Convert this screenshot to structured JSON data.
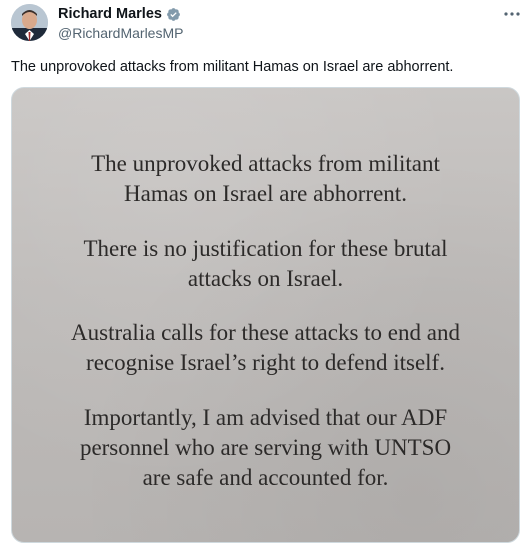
{
  "author": {
    "name": "Richard Marles",
    "handle": "@RichardMarlesMP",
    "verified_color": "#829aab"
  },
  "tweet": {
    "text": "The unprovoked attacks from militant Hamas on Israel are abhorrent."
  },
  "media": {
    "paragraphs": [
      [
        "The unprovoked attacks from militant",
        "Hamas on Israel are abhorrent."
      ],
      [
        "There is no justification for these brutal",
        "attacks on Israel."
      ],
      [
        "Australia calls for these attacks to end and",
        "recognise Israel’s right to defend itself."
      ],
      [
        "Importantly, I am advised that our ADF",
        "personnel who are serving with UNTSO",
        "are safe and accounted for."
      ]
    ]
  },
  "icons": {
    "verified": "verified-badge-icon",
    "more": "more-options-icon"
  }
}
